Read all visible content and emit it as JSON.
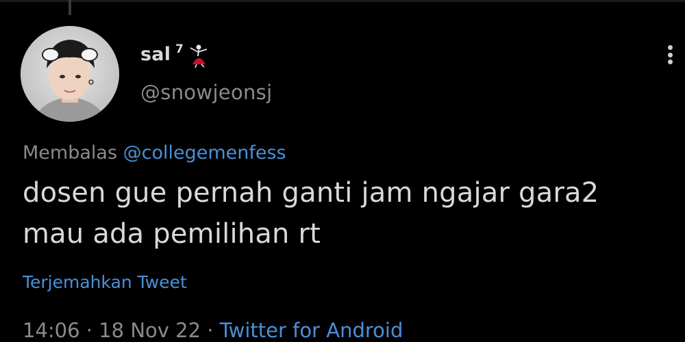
{
  "user": {
    "display_name": "sal",
    "badge": "7",
    "handle": "@snowjeonsj",
    "badge_icon": "dancer-emoji-icon"
  },
  "reply": {
    "prefix": "Membalas",
    "mention": "@collegemenfess"
  },
  "tweet": {
    "text_line1": "dosen gue pernah ganti jam ngajar gara2",
    "text_line2": "mau ada pemilihan rt"
  },
  "translate_label": "Terjemahkan Tweet",
  "meta": {
    "time": "14:06",
    "date": "18 Nov 22",
    "separator": "·",
    "source": "Twitter for Android"
  },
  "menu_icon": "more-vertical-icon",
  "colors": {
    "background": "#000000",
    "text": "#d9d9d9",
    "muted": "#8b8b8b",
    "link": "#4a90d9"
  }
}
